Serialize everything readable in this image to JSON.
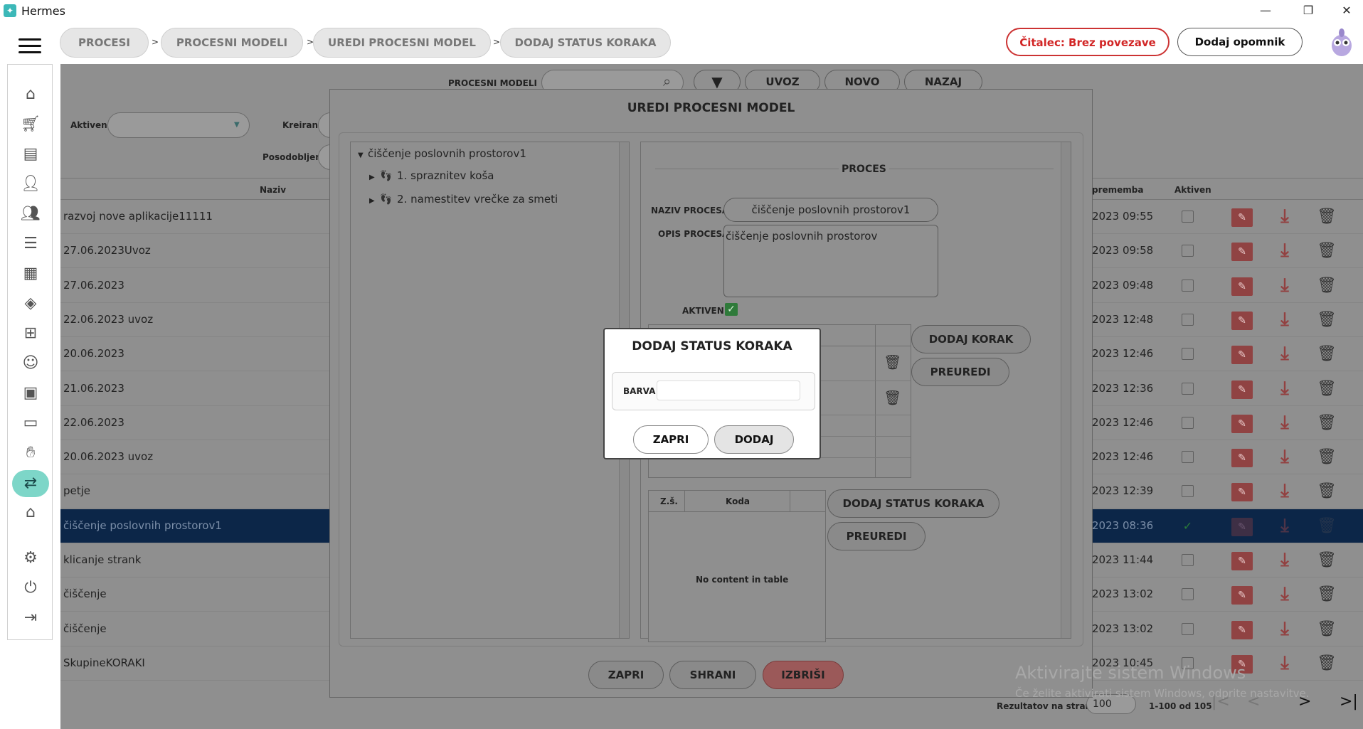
{
  "window": {
    "title": "Hermes",
    "controls": [
      "—",
      "❐",
      "✕"
    ]
  },
  "breadcrumbs": [
    "PROCESI",
    "PROCESNI MODELI",
    "UREDI PROCESNI MODEL",
    "DODAJ STATUS KORAKA"
  ],
  "breadcrumb_sep": ">",
  "header": {
    "reader_status": "Čitalec: Brez povezave",
    "add_reminder": "Dodaj opomnik"
  },
  "sidebar": {
    "icons": [
      "home-icon",
      "cart-icon",
      "document-icon",
      "person-icon",
      "people-icon",
      "list-icon",
      "calendar-icon",
      "layers-icon",
      "hierarchy-icon",
      "worker-icon",
      "briefcase-icon",
      "chat-icon",
      "handshake-icon",
      "process-icon",
      "house-icon",
      "gear-icon",
      "power-icon",
      "logout-icon"
    ]
  },
  "background_page": {
    "search_label": "PROCESNI MODELI",
    "buttons": {
      "import": "UVOZ",
      "new": "NOVO",
      "back": "NAZAJ"
    },
    "filters": {
      "active": "Aktiven",
      "created": "Kreiran",
      "updated": "Posodobljen"
    },
    "columns": {
      "name": "Naziv",
      "change": "premembа",
      "active": "Aktiven"
    },
    "rows": [
      {
        "name": "razvoj nove aplikacije11111",
        "date": "2023 09:55"
      },
      {
        "name": "27.06.2023Uvoz",
        "date": "2023 09:58"
      },
      {
        "name": "27.06.2023",
        "date": "2023 09:48"
      },
      {
        "name": "22.06.2023 uvoz",
        "date": "2023 12:48"
      },
      {
        "name": "20.06.2023",
        "date": "2023 12:46"
      },
      {
        "name": "21.06.2023",
        "date": "2023 12:36"
      },
      {
        "name": "22.06.2023",
        "date": "2023 12:46"
      },
      {
        "name": "20.06.2023 uvoz",
        "date": "2023 12:46"
      },
      {
        "name": "petje",
        "date": "2023 12:39"
      },
      {
        "name": "čiščenje poslovnih prostorov1",
        "date": "2023 08:36",
        "selected": true
      },
      {
        "name": "klicanje strank",
        "date": "2023 11:44"
      },
      {
        "name": "čiščenje",
        "date": "2023 13:02"
      },
      {
        "name": "čiščenje",
        "date": "2023 13:02"
      },
      {
        "name": "SkupineKORAKI",
        "date": "2023 10:45"
      }
    ],
    "pagination": {
      "per_page_label": "Rezultatov na stran",
      "per_page_value": "100",
      "range": "1-100 od 105"
    }
  },
  "modal": {
    "title": "UREDI PROCESNI MODEL",
    "tree": {
      "root": "čiščenje poslovnih prostorov1",
      "children": [
        "1. spraznitev koša",
        "2. namestitev vrečke za smeti"
      ]
    },
    "section_title": "PROCES",
    "name_label": "NAZIV PROCESA",
    "name_value": "čiščenje poslovnih prostorov1",
    "desc_label": "OPIS PROCESA",
    "desc_value": "čiščenje poslovnih prostorov",
    "active_label": "AKTIVEN",
    "add_step": "DODAJ KORAK",
    "reorder1": "PREUREDI",
    "status_table": {
      "col1": "Z.š.",
      "col2": "Koda",
      "empty": "No content in table"
    },
    "add_status": "DODAJ STATUS KORAKA",
    "reorder2": "PREUREDI",
    "footer": {
      "close": "ZAPRI",
      "save": "SHRANI",
      "delete": "IZBRIŠI"
    }
  },
  "dialog": {
    "title": "DODAJ STATUS KORAKA",
    "color_label": "BARVA",
    "color_value": "",
    "close": "ZAPRI",
    "add": "DODAJ"
  },
  "watermark": {
    "line1": "Aktivirajte sistem Windows",
    "line2": "Če želite aktivirati sistem Windows, odprite nastavitve."
  }
}
